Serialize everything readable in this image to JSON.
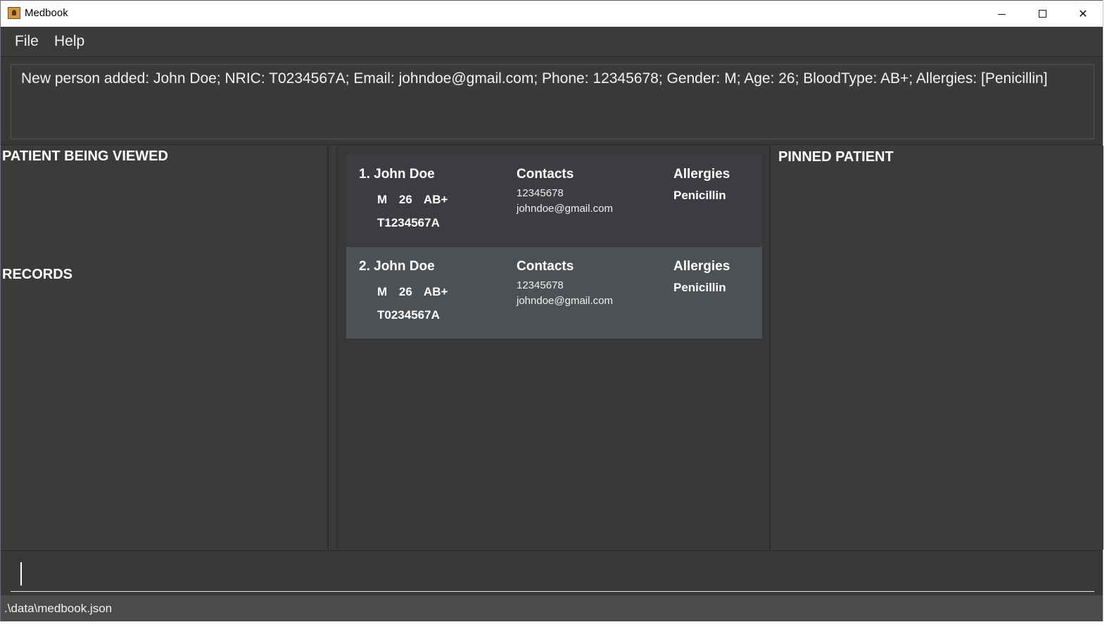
{
  "window": {
    "title": "Medbook",
    "controls": {
      "minimize_icon": "minimize-icon",
      "maximize_icon": "maximize-icon",
      "close_icon": "close-icon",
      "close_glyph": "✕"
    }
  },
  "menu": {
    "items": [
      {
        "label": "File"
      },
      {
        "label": "Help"
      }
    ]
  },
  "result": {
    "message": "New person added: John Doe; NRIC: T0234567A; Email: johndoe@gmail.com; Phone: 12345678; Gender: M; Age: 26; BloodType: AB+; Allergies: [Penicillin]"
  },
  "left_panel": {
    "viewed_heading": "PATIENT BEING VIEWED",
    "records_heading": "RECORDS"
  },
  "right_panel": {
    "pinned_heading": "PINNED PATIENT"
  },
  "patients": [
    {
      "name": "1. John Doe",
      "gender": "M",
      "age": "26",
      "blood_type": "AB+",
      "nric": "T1234567A",
      "contacts_label": "Contacts",
      "phone": "12345678",
      "email": "johndoe@gmail.com",
      "allergies_label": "Allergies",
      "allergy": "Penicillin"
    },
    {
      "name": "2. John Doe",
      "gender": "M",
      "age": "26",
      "blood_type": "AB+",
      "nric": "T0234567A",
      "contacts_label": "Contacts",
      "phone": "12345678",
      "email": "johndoe@gmail.com",
      "allergies_label": "Allergies",
      "allergy": "Penicillin"
    }
  ],
  "command": {
    "value": ""
  },
  "status": {
    "file_path": ".\\data\\medbook.json"
  },
  "colors": {
    "background": "#3b3b3b",
    "card_selected": "#4d5154",
    "card_default": "#3b3d40",
    "text": "#ffffff"
  }
}
